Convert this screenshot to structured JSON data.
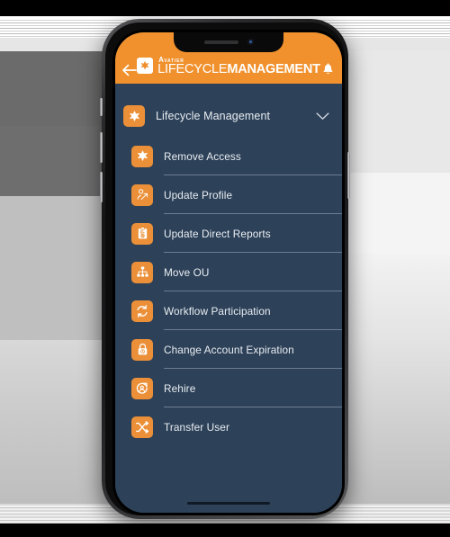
{
  "app": {
    "header": {
      "back_icon": "back-arrow-icon",
      "logo_icon": "avatier-star-logo-icon",
      "brand_top_cap": "A",
      "brand_top_rest": "VATIER",
      "brand_main_light": "LIFECYCLE",
      "brand_main_bold": "MANAGEMENT",
      "notification_icon": "bell-icon",
      "bg_color": "#f0912d"
    },
    "menu": {
      "bg_color": "#2d4159",
      "group": {
        "icon": "star-badge-icon",
        "title": "Lifecycle Management",
        "expand_icon": "chevron-down-icon",
        "expanded": true
      },
      "items": [
        {
          "icon": "star-badge-icon",
          "label": "Remove Access"
        },
        {
          "icon": "user-edit-icon",
          "label": "Update Profile"
        },
        {
          "icon": "clipboard-user-icon",
          "label": "Update Direct Reports"
        },
        {
          "icon": "org-chart-icon",
          "label": "Move OU"
        },
        {
          "icon": "refresh-cycle-icon",
          "label": "Workflow Participation"
        },
        {
          "icon": "lock-clock-icon",
          "label": "Change Account Expiration"
        },
        {
          "icon": "rehire-refresh-icon",
          "label": "Rehire"
        },
        {
          "icon": "shuffle-arrows-icon",
          "label": "Transfer User"
        }
      ]
    },
    "device": {
      "home_indicator": "home-indicator",
      "notch_speaker": "speaker-grille",
      "notch_camera": "front-camera"
    },
    "accent_color": "#eb9038",
    "tile_color": "#eb9038",
    "text_color": "#e9edf1"
  }
}
